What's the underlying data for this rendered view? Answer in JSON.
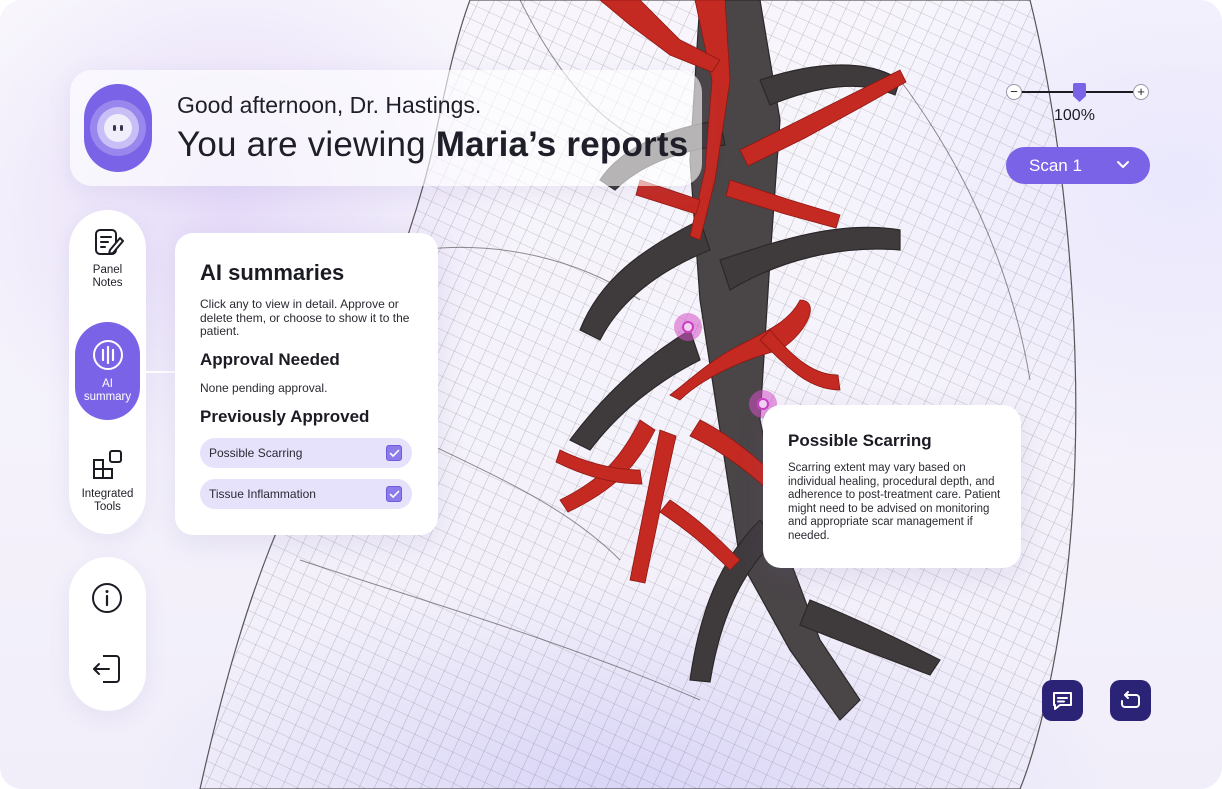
{
  "greeting": {
    "line1": "Good afternoon, Dr. Hastings.",
    "line2_prefix": "You are viewing ",
    "line2_bold": "Maria’s reports"
  },
  "sidebar": {
    "items": [
      {
        "label_line1": "Panel",
        "label_line2": "Notes",
        "icon": "notes-edit-icon"
      },
      {
        "label_line1": "AI",
        "label_line2": "summary",
        "icon": "audio-wave-icon",
        "active": true
      },
      {
        "label_line1": "Integrated",
        "label_line2": "Tools",
        "icon": "tools-grid-icon"
      }
    ],
    "bottom_icons": [
      "info-icon",
      "logout-icon"
    ]
  },
  "ai_panel": {
    "title": "AI summaries",
    "description": "Click any to view in detail. Approve or delete them, or choose to show it to the patient.",
    "approval_heading": "Approval Needed",
    "approval_empty": "None pending approval.",
    "approved_heading": "Previously Approved",
    "approved_items": [
      {
        "label": "Possible Scarring",
        "checked": true
      },
      {
        "label": "Tissue Inflammation",
        "checked": true
      }
    ]
  },
  "finding": {
    "title": "Possible Scarring",
    "body": "Scarring extent may vary based on individual healing, procedural depth, and adherence to post-treatment care. Patient might need to be advised on monitoring and appropriate scar management if needed."
  },
  "zoom": {
    "minus": "−",
    "plus": "+",
    "label": "100%",
    "level": 0.5
  },
  "scan_select": {
    "selected": "Scan 1"
  },
  "actions": [
    "chat-icon",
    "rotate-icon"
  ],
  "colors": {
    "accent": "#7a63e6",
    "accent_dark": "#2b2376",
    "vessel_red": "#c42a22",
    "bronchi_dark": "#3e3a3c",
    "marker": "#d650c8"
  }
}
